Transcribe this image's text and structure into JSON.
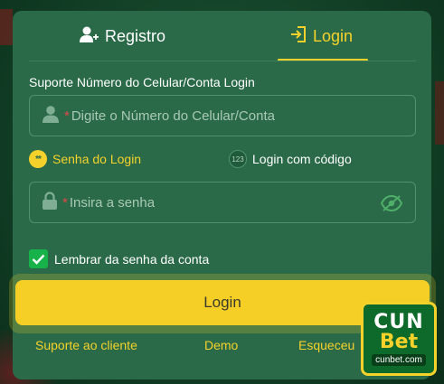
{
  "tabs": {
    "register_label": "Registro",
    "login_label": "Login",
    "active": "login"
  },
  "account": {
    "label": "Suporte Número do Celular/Conta Login",
    "placeholder": "Digite o Número do Celular/Conta",
    "required_mark": "*"
  },
  "login_mode": {
    "password_badge": "**",
    "password_label": "Senha do Login",
    "code_badge": "123",
    "code_label": "Login com código",
    "selected": "password"
  },
  "password": {
    "placeholder": "Insira a senha",
    "required_mark": "*"
  },
  "remember": {
    "label": "Lembrar da senha da conta",
    "checked": true
  },
  "login_button": {
    "label": "Login"
  },
  "links": {
    "support": "Suporte ao cliente",
    "demo": "Demo",
    "forgot": "Esqueceu"
  },
  "logo": {
    "line1": "CUN",
    "line2": "Bet",
    "domain": "cunbet.com"
  },
  "colors": {
    "accent": "#f5d22b",
    "panel": "#2a6a48",
    "checkbox": "#17b34a",
    "required": "#e04848"
  },
  "icons": [
    "add-user-icon",
    "login-door-icon",
    "user-icon",
    "lock-icon",
    "eye-off-icon",
    "check-icon"
  ]
}
